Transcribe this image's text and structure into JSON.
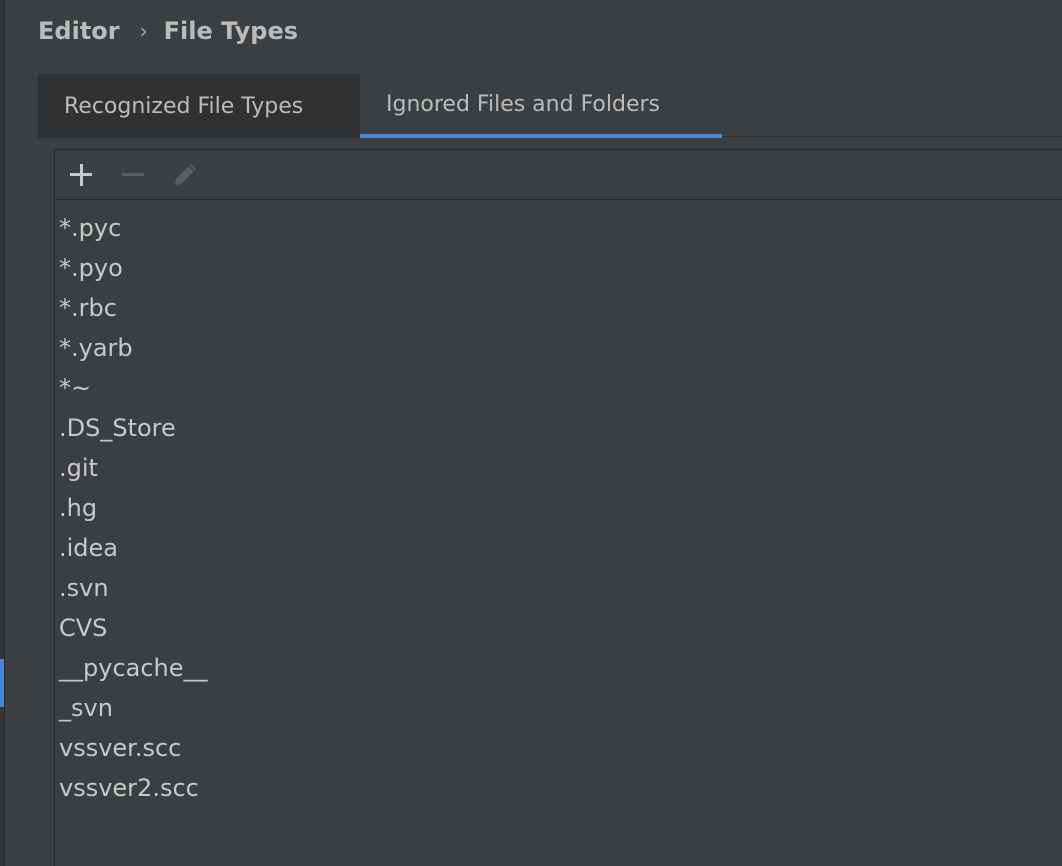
{
  "breadcrumb": {
    "parent": "Editor",
    "separator": "›",
    "current": "File Types"
  },
  "tabs": [
    {
      "label": "Recognized File Types",
      "active": false
    },
    {
      "label": "Ignored Files and Folders",
      "active": true
    }
  ],
  "toolbar": {
    "add_icon": "plus-icon",
    "remove_icon": "minus-icon",
    "edit_icon": "pencil-icon"
  },
  "ignored_items": [
    "*.pyc",
    "*.pyo",
    "*.rbc",
    "*.yarb",
    "*~",
    ".DS_Store",
    ".git",
    ".hg",
    ".idea",
    ".svn",
    "CVS",
    "__pycache__",
    "_svn",
    "vssver.scc",
    "vssver2.scc"
  ],
  "colors": {
    "background": "#3c3f41",
    "accent": "#4a88c7",
    "text": "#bbbbbb"
  }
}
